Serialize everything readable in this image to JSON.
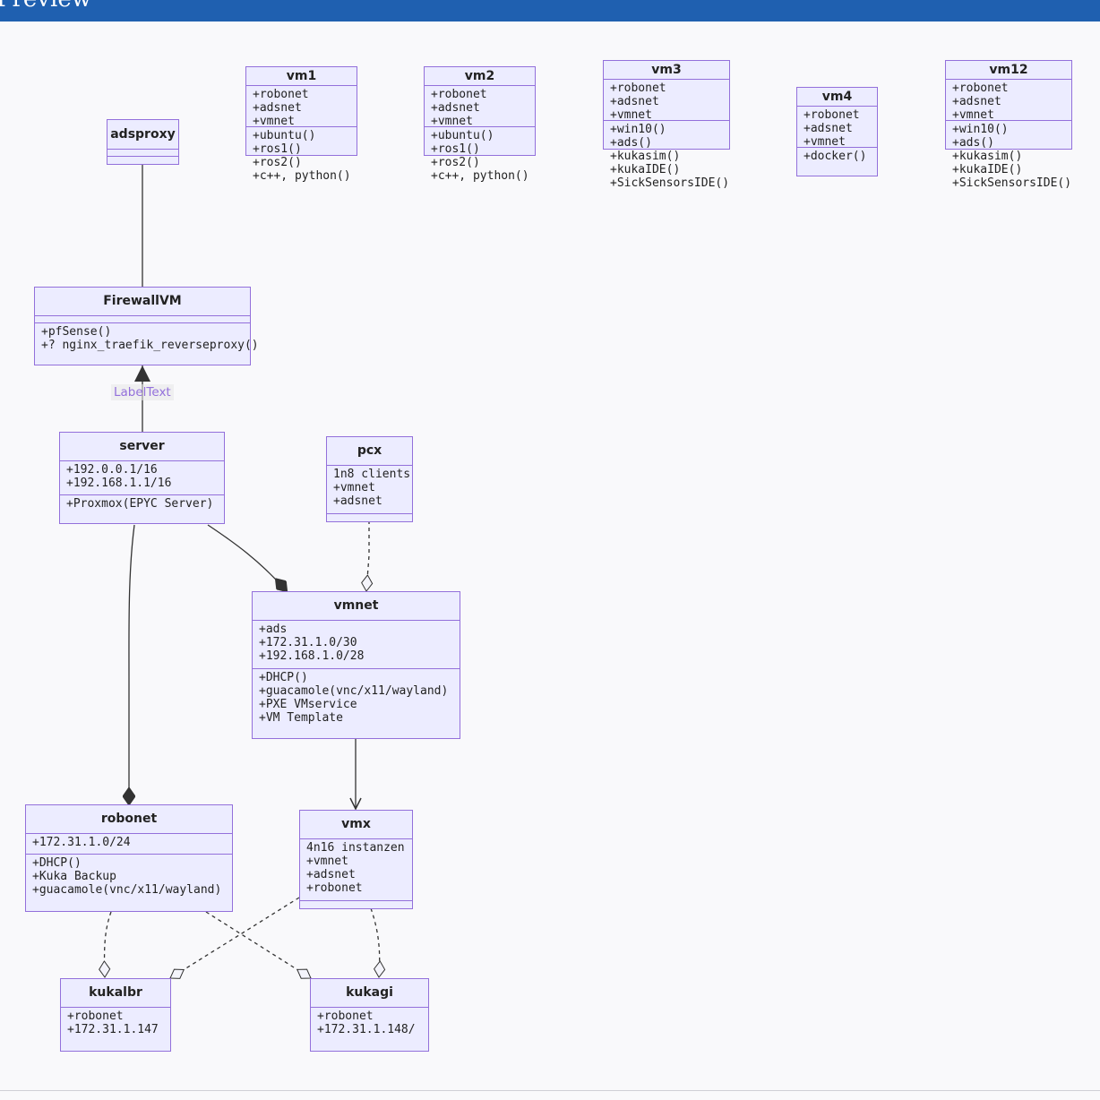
{
  "header": {
    "title": "Preview"
  },
  "edge_label": "LabelText",
  "colors": {
    "node_fill": "#ececff",
    "node_border": "#9370db",
    "edge": "#333333",
    "header": "#1f60b0"
  },
  "classes": [
    {
      "id": "vm1",
      "name": "vm1",
      "attributes": [
        "+robonet",
        "+adsnet",
        "+vmnet"
      ],
      "methods": [
        "+ubuntu()",
        "+ros1()",
        "+ros2()",
        "+c++, python()"
      ]
    },
    {
      "id": "vm2",
      "name": "vm2",
      "attributes": [
        "+robonet",
        "+adsnet",
        "+vmnet"
      ],
      "methods": [
        "+ubuntu()",
        "+ros1()",
        "+ros2()",
        "+c++, python()"
      ]
    },
    {
      "id": "vm3",
      "name": "vm3",
      "attributes": [
        "+robonet",
        "+adsnet",
        "+vmnet"
      ],
      "methods": [
        "+win10()",
        "+ads()",
        "+kukasim()",
        "+kukaIDE()",
        "+SickSensorsIDE()"
      ]
    },
    {
      "id": "vm4",
      "name": "vm4",
      "attributes": [
        "+robonet",
        "+adsnet",
        "+vmnet"
      ],
      "methods": [
        "+docker()"
      ]
    },
    {
      "id": "vm12",
      "name": "vm12",
      "attributes": [
        "+robonet",
        "+adsnet",
        "+vmnet"
      ],
      "methods": [
        "+win10()",
        "+ads()",
        "+kukasim()",
        "+kukaIDE()",
        "+SickSensorsIDE()"
      ]
    },
    {
      "id": "adsproxy",
      "name": "adsproxy",
      "attributes": [],
      "methods": []
    },
    {
      "id": "firewallvm",
      "name": "FirewallVM",
      "attributes": [],
      "methods": [
        "+pfSense()",
        "+? nginx_traefik_reverseproxy()"
      ]
    },
    {
      "id": "server",
      "name": "server",
      "attributes": [
        "+192.0.0.1/16",
        "+192.168.1.1/16"
      ],
      "methods": [
        "+Proxmox(EPYC Server)"
      ]
    },
    {
      "id": "pcx",
      "name": "pcx",
      "attributes": [
        "1n8 clients",
        "+vmnet",
        "+adsnet"
      ],
      "methods": []
    },
    {
      "id": "vmnet",
      "name": "vmnet",
      "attributes": [
        "+ads",
        "+172.31.1.0/30",
        "+192.168.1.0/28"
      ],
      "methods": [
        "+DHCP()",
        "+guacamole(vnc/x11/wayland)",
        "+PXE VMservice",
        "+VM Template"
      ]
    },
    {
      "id": "robonet",
      "name": "robonet",
      "attributes": [
        "+172.31.1.0/24"
      ],
      "methods": [
        "+DHCP()",
        "+Kuka Backup",
        "+guacamole(vnc/x11/wayland)"
      ]
    },
    {
      "id": "vmx",
      "name": "vmx",
      "attributes": [
        "4n16 instanzen",
        "+vmnet",
        "+adsnet",
        "+robonet"
      ],
      "methods": []
    },
    {
      "id": "kukalbr",
      "name": "kukalbr",
      "attributes": [
        "+robonet",
        "+172.31.1.147"
      ],
      "methods": []
    },
    {
      "id": "kukagi",
      "name": "kukagi",
      "attributes": [
        "+robonet",
        "+172.31.1.148/"
      ],
      "methods": []
    }
  ]
}
